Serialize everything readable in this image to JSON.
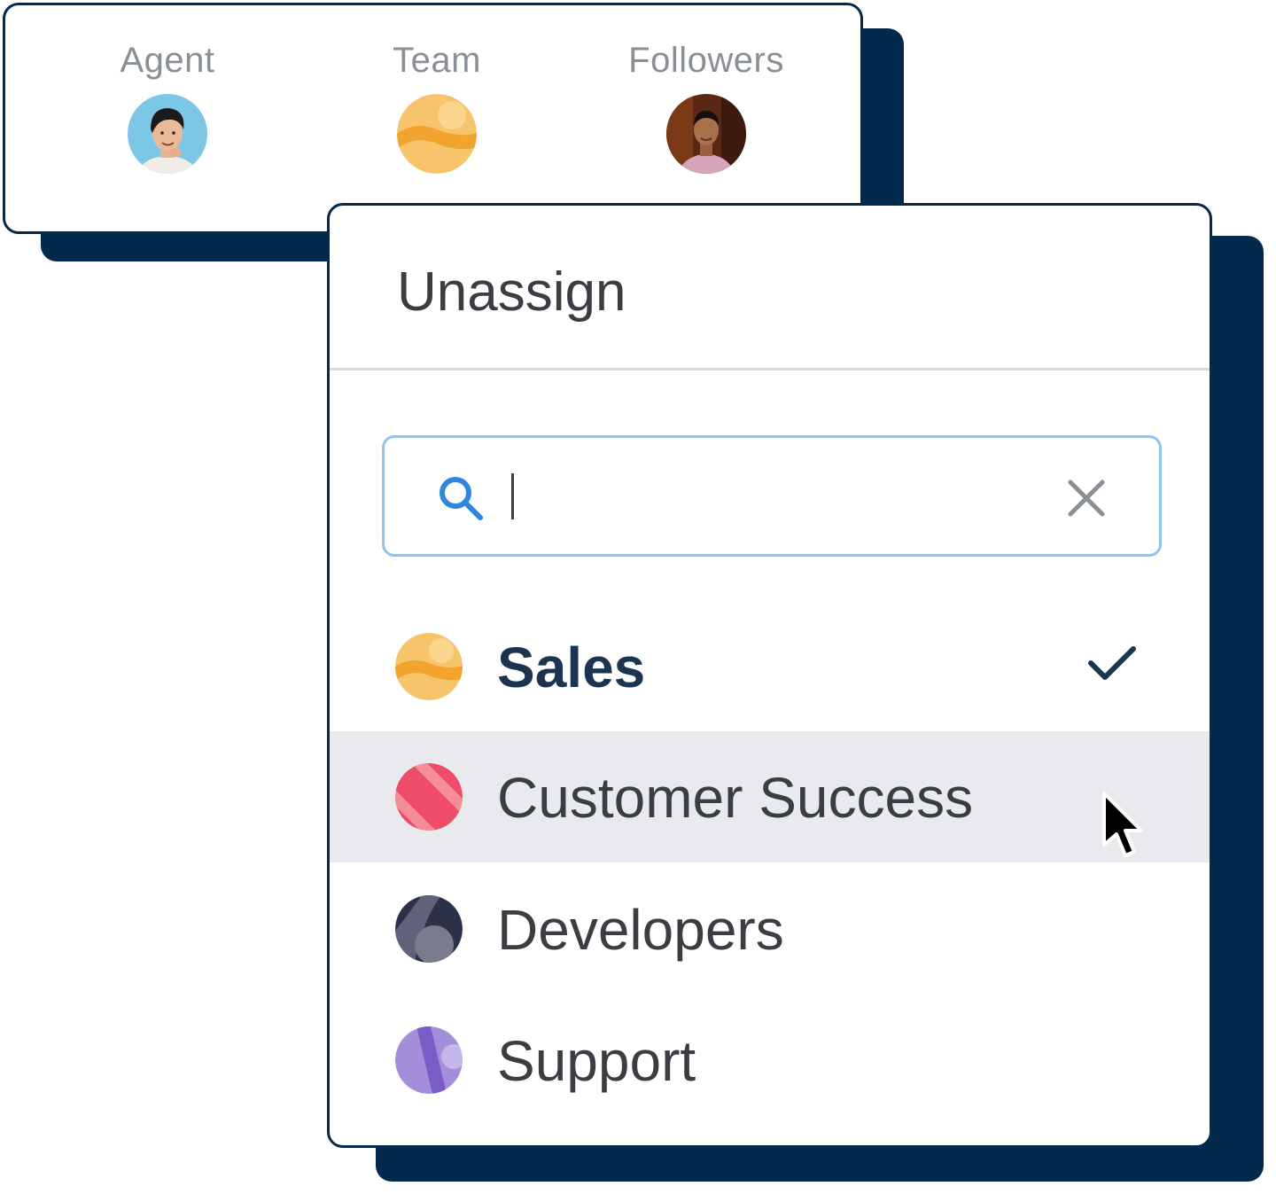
{
  "assignment": {
    "agent_label": "Agent",
    "team_label": "Team",
    "followers_label": "Followers"
  },
  "menu": {
    "title": "Unassign",
    "search": {
      "value": "",
      "placeholder": ""
    },
    "options": [
      {
        "label": "Sales",
        "color": "#f5b63f",
        "selected": true
      },
      {
        "label": "Customer Success",
        "color": "#ee4d6a",
        "hovered": true
      },
      {
        "label": "Developers",
        "color": "#2c3147"
      },
      {
        "label": "Support",
        "color": "#8a6cd0"
      }
    ]
  },
  "colors": {
    "shadow": "#03294d",
    "search_border": "#8fc4ef",
    "search_icon": "#2f86dc",
    "hover_row": "#e8eaed",
    "check": "#1b3550"
  },
  "icons": [
    "search-icon",
    "close-icon",
    "check-icon",
    "cursor-icon"
  ]
}
